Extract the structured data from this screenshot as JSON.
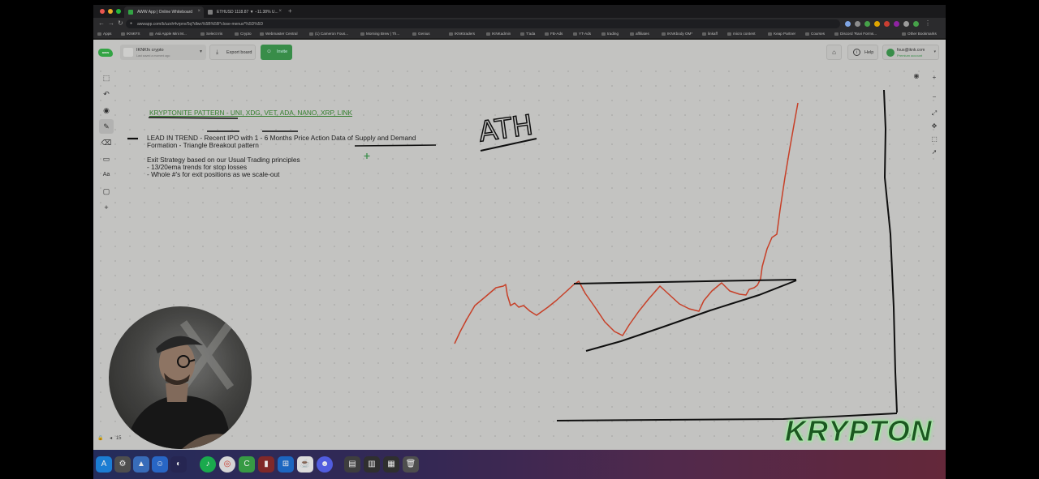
{
  "browser": {
    "tabs": [
      {
        "label": "AWW App | Online Whiteboard",
        "active": true
      },
      {
        "label": "ETHUSD 1118.87 ▼ −11.38% U...",
        "active": false
      }
    ],
    "url": "awwapp.com/b/uzxh4vrpnv/5q?dlwc%5B%5B*close-menus*%5D%5D",
    "bookmarks": [
      "Apps",
      "IKNKFX",
      "Asii Apple Mini M...",
      "Select Iris",
      "Crypto",
      "Webmaster Central",
      "(1) Cameron Fous...",
      "Morning Brew | Th...",
      "Genius",
      "IKNKtraders",
      "IKNKadmin",
      "T'ada",
      "FB-Ads",
      "YT-Ads",
      "trading",
      "affiliates",
      "IKNKbody OM*",
      "linkaff",
      "micro content",
      "Keap Partner",
      "Courses",
      "Discord 'Ravi Forms...",
      "Other Bookmarks"
    ]
  },
  "app": {
    "logo": "aww",
    "board": {
      "name": "IKNKfx crypto",
      "subtitle": "Last saved a moment ago"
    },
    "export_label": "Export board",
    "invite_label": "Invite",
    "help_label": "Help",
    "account": {
      "email": "fous@iknk.com",
      "plan": "Premium account"
    },
    "page_number": "15"
  },
  "notes": {
    "title": "KRYPTONITE PATTERN - UNI, XDG, VET, ADA, NANO, XRP, LINK",
    "lead_line1": "LEAD IN TREND - Recent IPO with 1 - 6 Months Price Action Data of Supply and Demand",
    "lead_line2": "Formation - Triangle Breakout pattern",
    "exit_heading": "Exit Strategy based on our Usual Trading principles",
    "exit_item1": "- 13/20ema trends  for stop losses",
    "exit_item2": "- Whole #'s for exit positions as we scale-out"
  },
  "drawing": {
    "ath_label": "ATH",
    "price_line_color": "#d8452b",
    "ink_color": "#111111"
  },
  "watermark": "KRYPTON",
  "colors": {
    "accent_green": "#3d9a50",
    "title_green": "#3a8a33",
    "canvas_bg": "#d4d4d2"
  }
}
